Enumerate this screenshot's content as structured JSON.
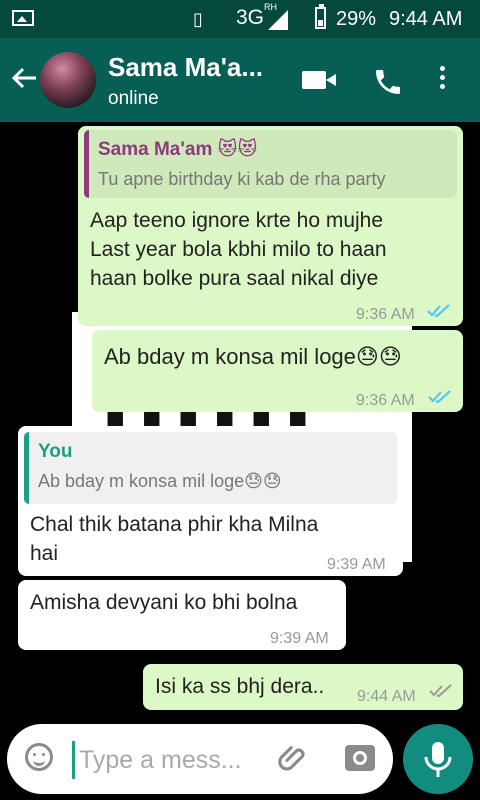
{
  "status_bar": {
    "network": "3G",
    "network_sup": "RH",
    "battery": "29%",
    "time": "9:44 AM"
  },
  "header": {
    "contact_name": "Sama Ma'a...",
    "contact_status": "online",
    "icons": [
      "back-arrow-icon",
      "video-call-icon",
      "phone-icon",
      "more-options-icon"
    ]
  },
  "messages": [
    {
      "direction": "out",
      "quote": {
        "name": "Sama Ma'am 😻😻",
        "text": "Tu apne birthday ki kab de rha party"
      },
      "lines": [
        "Aap teeno ignore krte ho mujhe",
        "Last year bola kbhi milo to haan",
        "haan bolke pura saal nikal diye"
      ],
      "time": "9:36 AM",
      "status": "read"
    },
    {
      "direction": "out",
      "lines": [
        "Ab bday m konsa mil loge😓😓"
      ],
      "time": "9:36 AM",
      "status": "read"
    },
    {
      "direction": "in",
      "quote": {
        "name": "You",
        "text": "Ab bday m konsa mil loge😓😓"
      },
      "lines": [
        "Chal thik batana phir kha Milna",
        "hai"
      ],
      "time": "9:39 AM"
    },
    {
      "direction": "in",
      "lines": [
        "Amisha devyani ko bhi bolna"
      ],
      "time": "9:39 AM"
    },
    {
      "direction": "out",
      "lines": [
        "Isi ka ss bhj dera.."
      ],
      "time": "9:44 AM",
      "status": "delivered"
    }
  ],
  "composer": {
    "placeholder": "Type a mess..."
  },
  "colors": {
    "status_bar": "#05493d",
    "toolbar": "#075e54",
    "outgoing_bubble": "#dcf8c6",
    "incoming_bubble": "#ffffff",
    "read_ticks": "#4fc3f7",
    "quote_author_sama": "#8e3a7e",
    "quote_author_you": "#1e9e88",
    "mic_button": "#128c7e"
  }
}
